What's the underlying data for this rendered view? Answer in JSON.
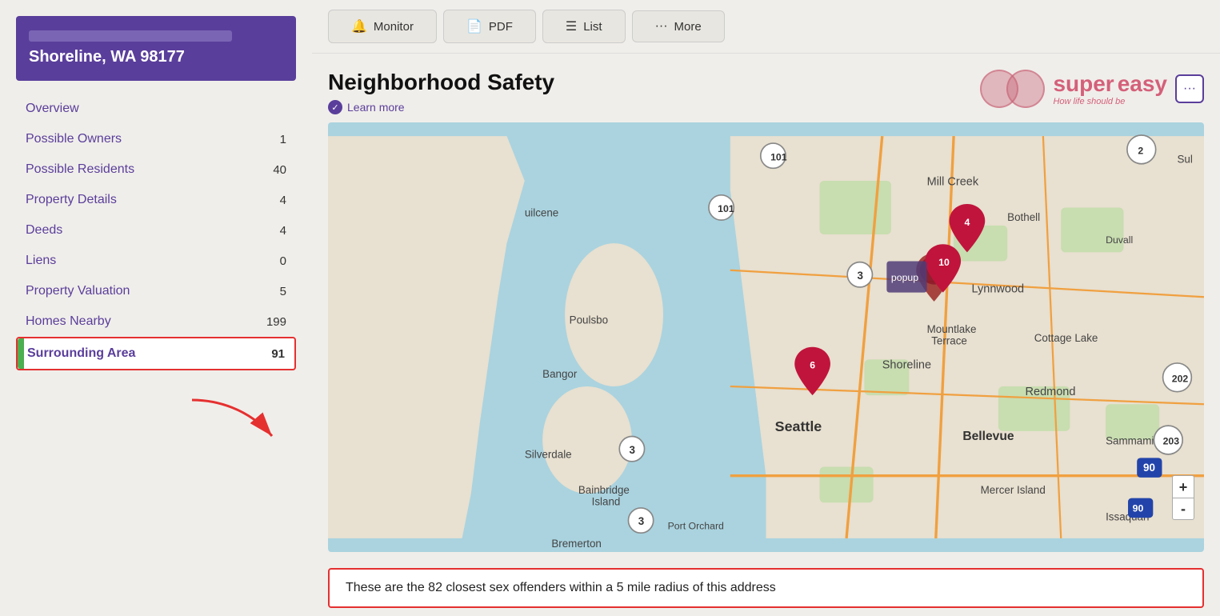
{
  "sidebar": {
    "address_blur": true,
    "city_label": "Shoreline, WA 98177",
    "nav_items": [
      {
        "id": "overview",
        "label": "Overview",
        "count": null,
        "active": false
      },
      {
        "id": "possible-owners",
        "label": "Possible Owners",
        "count": "1",
        "active": false
      },
      {
        "id": "possible-residents",
        "label": "Possible Residents",
        "count": "40",
        "active": false
      },
      {
        "id": "property-details",
        "label": "Property Details",
        "count": "4",
        "active": false
      },
      {
        "id": "deeds",
        "label": "Deeds",
        "count": "4",
        "active": false
      },
      {
        "id": "liens",
        "label": "Liens",
        "count": "0",
        "active": false
      },
      {
        "id": "property-valuation",
        "label": "Property Valuation",
        "count": "5",
        "active": false
      },
      {
        "id": "homes-nearby",
        "label": "Homes Nearby",
        "count": "199",
        "active": false
      },
      {
        "id": "surrounding-area",
        "label": "Surrounding Area",
        "count": "91",
        "active": true
      }
    ]
  },
  "toolbar": {
    "buttons": [
      {
        "id": "monitor",
        "icon": "🔔",
        "label": "Monitor"
      },
      {
        "id": "pdf",
        "icon": "📄",
        "label": "PDF"
      },
      {
        "id": "list",
        "icon": "📋",
        "label": "List"
      },
      {
        "id": "more",
        "icon": "···",
        "label": "More"
      }
    ]
  },
  "section": {
    "title": "Neighborhood Safety",
    "learn_more_label": "Learn more",
    "logo_super": "super",
    "logo_easy": "easy",
    "logo_tagline": "How life should be"
  },
  "map": {
    "zoom_plus": "+",
    "zoom_minus": "-"
  },
  "info_bar": {
    "text": "These are the 82 closest sex offenders within a 5 mile radius of this address"
  }
}
